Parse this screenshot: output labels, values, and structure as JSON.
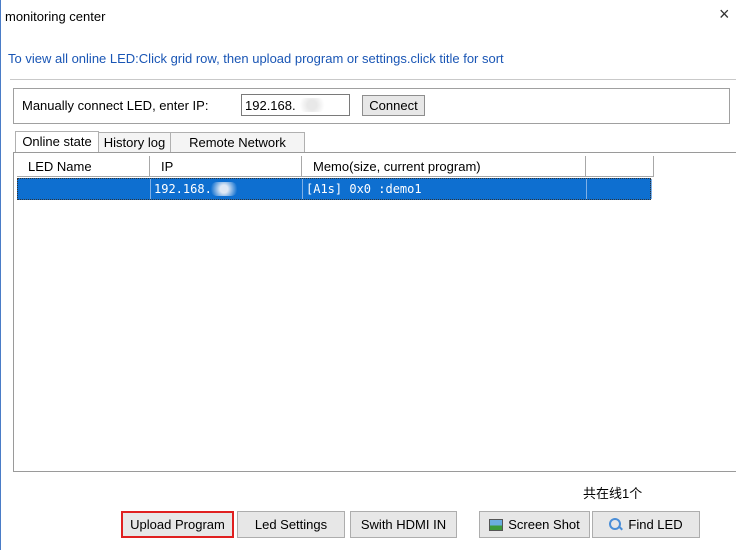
{
  "window": {
    "title": "monitoring center",
    "close_glyph": "×"
  },
  "hint": "To view all online LED:Click grid row, then upload program or settings.click title for sort",
  "connect": {
    "label": "Manually connect LED, enter IP:",
    "ip_value": "192.168.",
    "button_label": "Connect"
  },
  "tabs": [
    {
      "label": "Online state",
      "active": true
    },
    {
      "label": "History log",
      "active": false
    },
    {
      "label": "Remote Network",
      "active": false
    }
  ],
  "grid": {
    "columns": [
      "LED Name",
      "IP",
      "Memo(size, current program)",
      ""
    ],
    "rows": [
      {
        "led_name": "",
        "ip": "192.168.",
        "memo": "[A1s] 0x0 :demo1",
        "extra": "",
        "selected": true
      }
    ],
    "selection_color": "#0e6fd0"
  },
  "online_count": "共在线1个",
  "buttons": {
    "upload_program": "Upload Program",
    "led_settings": "Led Settings",
    "switch_hdmi": "Swith HDMI IN",
    "screen_shot": "Screen Shot",
    "find_led": "Find LED"
  },
  "highlight_color": "#e02020",
  "icons": {
    "screen_shot": "picture-icon",
    "find_led": "magnifier-icon"
  }
}
